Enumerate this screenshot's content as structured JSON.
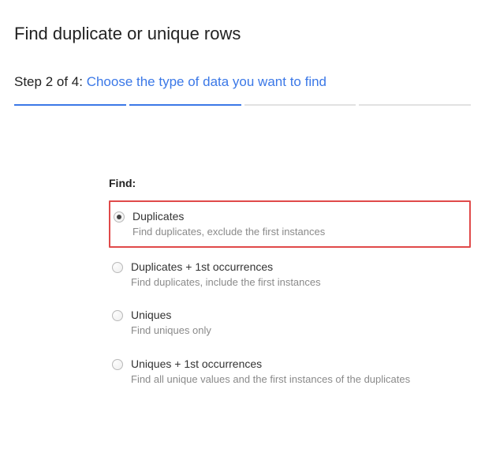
{
  "header": {
    "title": "Find duplicate or unique rows"
  },
  "step": {
    "prefix": "Step 2 of 4: ",
    "description": "Choose the type of data you want to find"
  },
  "find": {
    "label": "Find:",
    "options": [
      {
        "title": "Duplicates",
        "desc": "Find duplicates, exclude the first instances",
        "selected": true,
        "highlighted": true
      },
      {
        "title": "Duplicates + 1st occurrences",
        "desc": "Find duplicates, include the first instances",
        "selected": false,
        "highlighted": false
      },
      {
        "title": "Uniques",
        "desc": "Find uniques only",
        "selected": false,
        "highlighted": false
      },
      {
        "title": "Uniques + 1st occurrences",
        "desc": "Find all unique values and the first instances of the duplicates",
        "selected": false,
        "highlighted": false
      }
    ]
  }
}
